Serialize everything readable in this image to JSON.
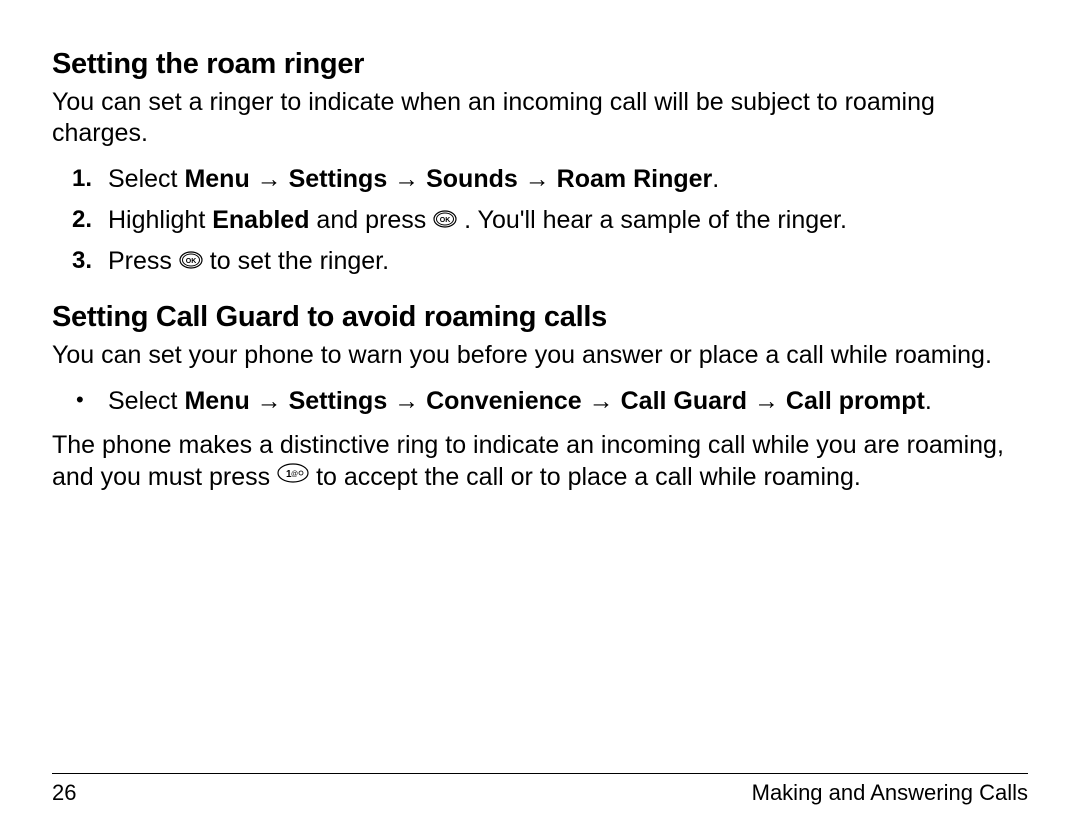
{
  "section1": {
    "heading": "Setting the roam ringer",
    "intro": "You can set a ringer to indicate when an incoming call will be subject to roaming charges.",
    "steps": {
      "s1_num": "1.",
      "s1_pre": "Select ",
      "s1_path": "Menu → Settings → Sounds → Roam Ringer",
      "s1_post": ".",
      "s2_num": "2.",
      "s2_pre": "Highlight ",
      "s2_bold": "Enabled",
      "s2_mid": " and press ",
      "s2_post": " . You'll hear a sample of the ringer.",
      "s3_num": "3.",
      "s3_pre": "Press ",
      "s3_post": "  to set the ringer."
    }
  },
  "section2": {
    "heading": "Setting Call Guard to avoid roaming calls",
    "intro": "You can set your phone to warn you before you answer or place a call while roaming.",
    "bullet_pre": "Select ",
    "bullet_path": "Menu → Settings → Convenience → Call Guard → Call prompt",
    "bullet_post": ".",
    "after_pre": "The phone makes a distinctive ring to indicate an incoming call while you are roaming, and you must press ",
    "after_post": "  to accept the call or to place a call while roaming."
  },
  "footer": {
    "page": "26",
    "title": "Making and Answering Calls"
  }
}
